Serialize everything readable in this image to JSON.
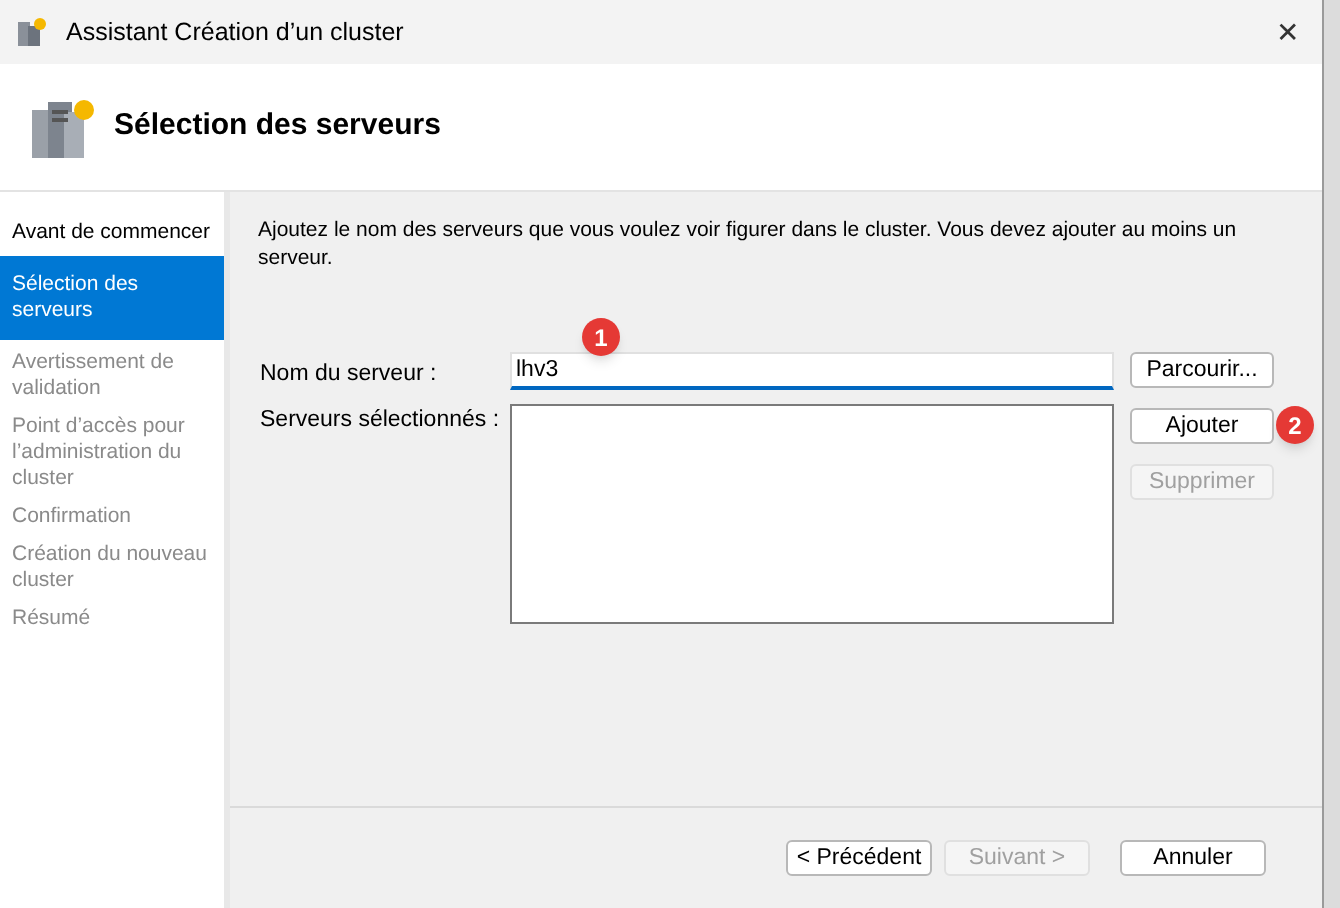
{
  "window": {
    "title": "Assistant Création d’un cluster",
    "close": "✕"
  },
  "header": {
    "title": "Sélection des serveurs"
  },
  "steps": [
    {
      "label": "Avant de commencer",
      "selected": false,
      "disabled": false
    },
    {
      "label": "Sélection des serveurs",
      "selected": true,
      "disabled": false
    },
    {
      "label": "Avertissement de validation",
      "selected": false,
      "disabled": true
    },
    {
      "label": "Point d’accès pour l’administration du cluster",
      "selected": false,
      "disabled": true
    },
    {
      "label": "Confirmation",
      "selected": false,
      "disabled": true
    },
    {
      "label": "Création du nouveau cluster",
      "selected": false,
      "disabled": true
    },
    {
      "label": "Résumé",
      "selected": false,
      "disabled": true
    }
  ],
  "description": "Ajoutez le nom des serveurs que vous voulez voir figurer dans le cluster. Vous devez ajouter au moins un serveur.",
  "server_name": {
    "label": "Nom du serveur :",
    "value": "lhv3"
  },
  "selected_servers": {
    "label": "Serveurs sélectionnés :"
  },
  "side_buttons": [
    {
      "label": "Parcourir...",
      "disabled": false
    },
    {
      "label": "Ajouter",
      "disabled": false
    },
    {
      "label": "Supprimer",
      "disabled": true
    }
  ],
  "footer_buttons": [
    {
      "label": "< Précédent",
      "disabled": false
    },
    {
      "label": "Suivant >",
      "disabled": true
    },
    {
      "label": "Annuler",
      "disabled": false
    }
  ],
  "annotations": [
    {
      "label": "1"
    },
    {
      "label": "2"
    }
  ]
}
